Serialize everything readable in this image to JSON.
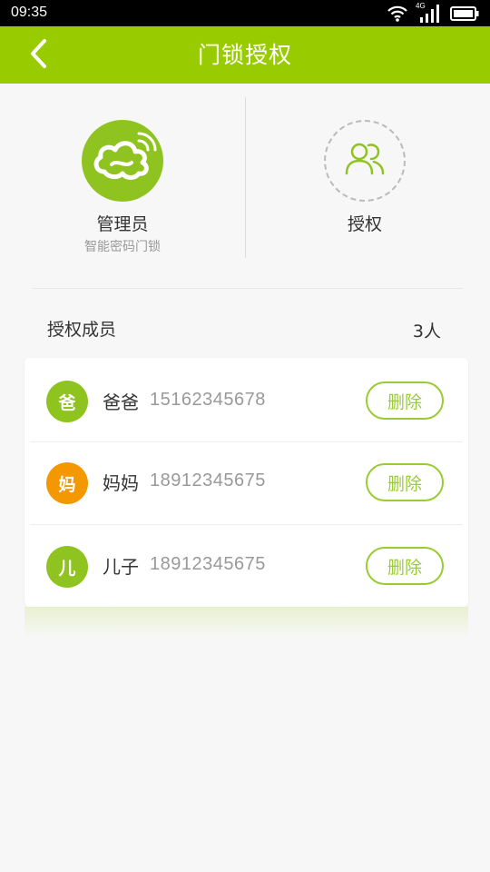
{
  "status_bar": {
    "time": "09:35",
    "network": "4G",
    "icons": [
      "wifi-icon",
      "signal-icon",
      "battery-icon"
    ]
  },
  "header": {
    "title": "门锁授权",
    "back_icon": "chevron-left-icon",
    "color": "#99cc00"
  },
  "admin": {
    "label": "管理员",
    "subtitle": "智能密码门锁",
    "icon": "cloud-wifi-logo"
  },
  "authorize": {
    "label": "授权",
    "icon": "users-icon"
  },
  "members": {
    "title": "授权成员",
    "count": "3人",
    "delete_label": "删除",
    "items": [
      {
        "avatar_char": "爸",
        "name": "爸爸",
        "phone": "15162345678",
        "avatar_color": "#8fc31f"
      },
      {
        "avatar_char": "妈",
        "name": "妈妈",
        "phone": "18912345675",
        "avatar_color": "#f39800"
      },
      {
        "avatar_char": "儿",
        "name": "儿子",
        "phone": "18912345675",
        "avatar_color": "#8fc31f"
      }
    ]
  }
}
